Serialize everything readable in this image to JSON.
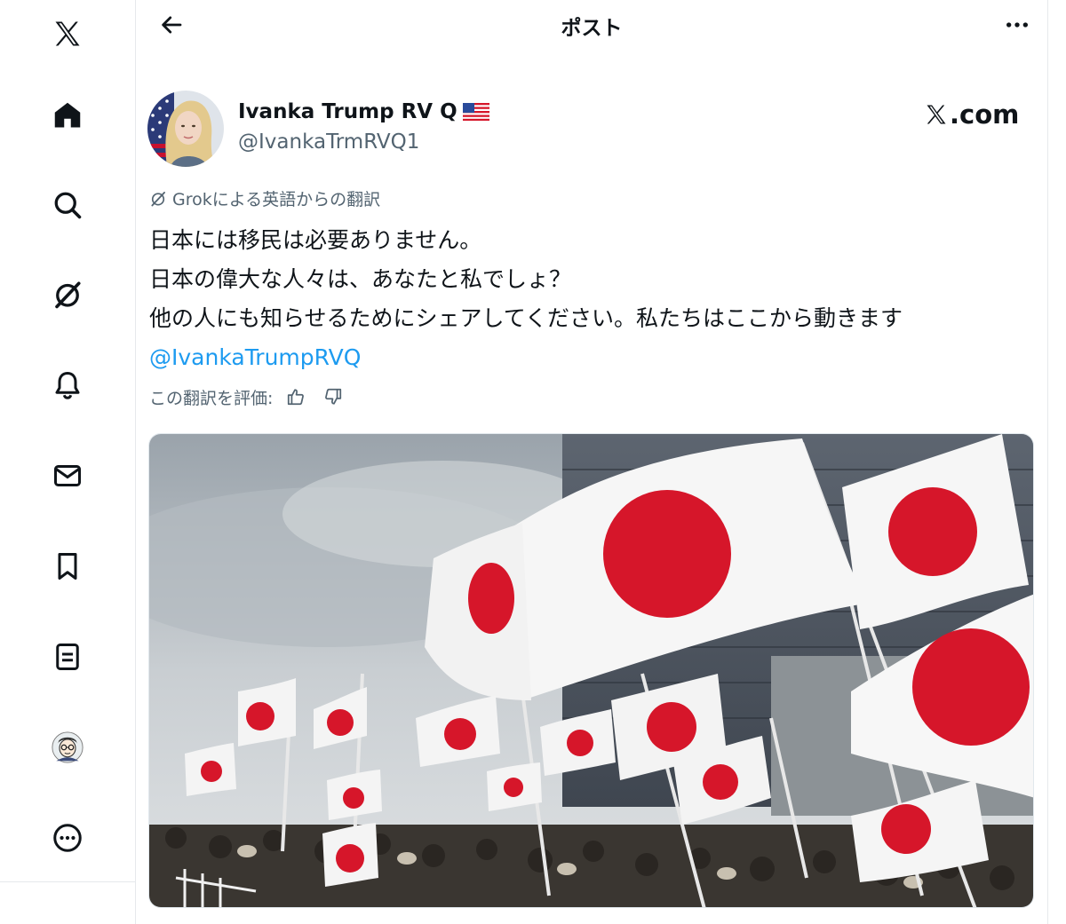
{
  "header": {
    "title": "ポスト"
  },
  "nav": {
    "items": [
      {
        "icon": "x-logo-icon"
      },
      {
        "icon": "home-icon"
      },
      {
        "icon": "search-icon"
      },
      {
        "icon": "grok-icon"
      },
      {
        "icon": "notifications-icon"
      },
      {
        "icon": "messages-icon"
      },
      {
        "icon": "bookmarks-icon"
      },
      {
        "icon": "lists-icon"
      },
      {
        "icon": "profile-avatar"
      },
      {
        "icon": "more-icon"
      }
    ]
  },
  "post": {
    "author": {
      "display_name": "Ivanka Trump RV Q",
      "handle": "@IvankaTrmRVQ1"
    },
    "source_logo": ".com",
    "translation_label": "Grokによる英語からの翻訳",
    "text_lines": [
      "日本には移民は必要ありません。",
      "日本の偉大な人々は、あなたと私でしょ？",
      "他の人にも知らせるためにシェアしてください。私たちはここから動きます"
    ],
    "mention": "@IvankaTrumpRVQ",
    "rate_translation_label": "この翻訳を評価:"
  },
  "colors": {
    "text": "#0f1419",
    "secondary": "#536471",
    "link": "#1d9bf0",
    "flag_red": "#d6162a"
  }
}
